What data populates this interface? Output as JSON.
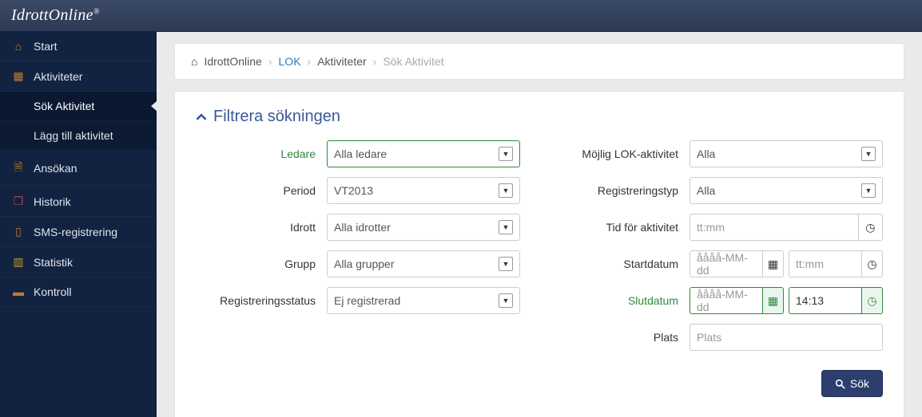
{
  "app_name": "IdrottOnline",
  "sidebar": {
    "items": [
      {
        "label": "Start",
        "icon": "home"
      },
      {
        "label": "Aktiviteter",
        "icon": "calendar"
      },
      {
        "label": "Sök Aktivitet",
        "sub": true,
        "active": true
      },
      {
        "label": "Lägg till aktivitet",
        "sub": true
      },
      {
        "label": "Ansökan",
        "icon": "file"
      },
      {
        "label": "Historik",
        "icon": "copy"
      },
      {
        "label": "SMS-registrering",
        "icon": "phone"
      },
      {
        "label": "Statistik",
        "icon": "chart"
      },
      {
        "label": "Kontroll",
        "icon": "book"
      }
    ]
  },
  "breadcrumb": {
    "home": "IdrottOnline",
    "lok": "LOK",
    "aktiviteter": "Aktiviteter",
    "current": "Sök Aktivitet"
  },
  "filter": {
    "title": "Filtrera sökningen",
    "left": {
      "ledare": {
        "label": "Ledare",
        "value": "Alla ledare"
      },
      "period": {
        "label": "Period",
        "value": "VT2013"
      },
      "idrott": {
        "label": "Idrott",
        "value": "Alla idrotter"
      },
      "grupp": {
        "label": "Grupp",
        "value": "Alla grupper"
      },
      "regstatus": {
        "label": "Registreringsstatus",
        "value": "Ej registrerad"
      }
    },
    "right": {
      "mojlig": {
        "label": "Möjlig LOK-aktivitet",
        "value": "Alla"
      },
      "regtyp": {
        "label": "Registreringstyp",
        "value": "Alla"
      },
      "tid": {
        "label": "Tid för aktivitet",
        "placeholder": "tt:mm"
      },
      "startdatum": {
        "label": "Startdatum",
        "date_placeholder": "åååå-MM-dd",
        "time_placeholder": "tt:mm"
      },
      "slutdatum": {
        "label": "Slutdatum",
        "date_placeholder": "åååå-MM-dd",
        "time_value": "14:13"
      },
      "plats": {
        "label": "Plats",
        "placeholder": "Plats"
      }
    }
  },
  "search_button": "Sök"
}
